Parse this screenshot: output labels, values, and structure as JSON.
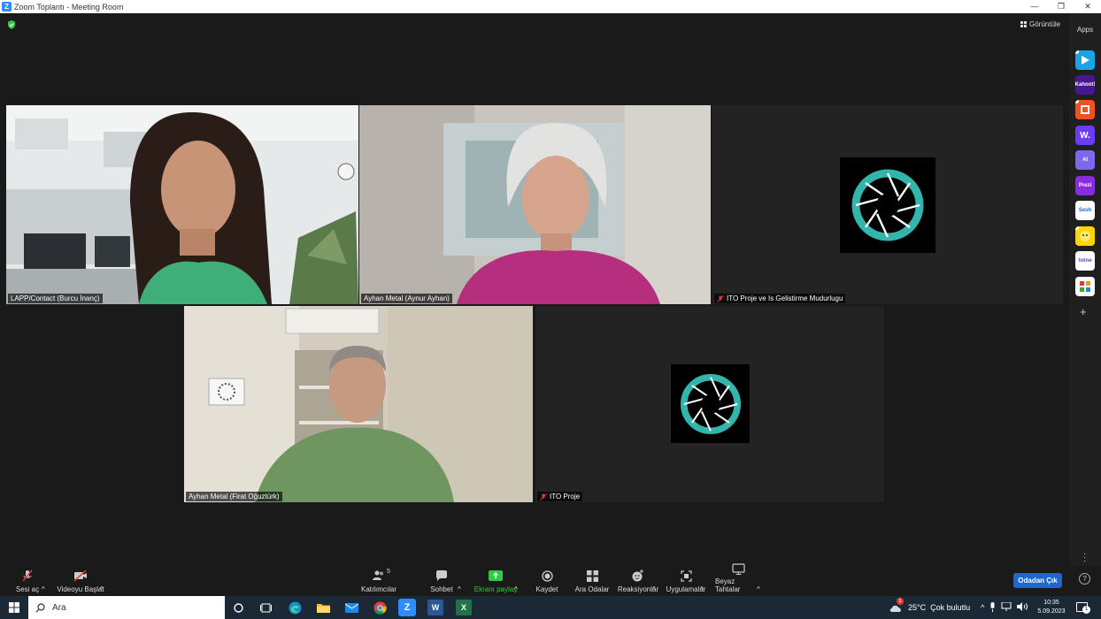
{
  "window": {
    "title": "Zoom Toplantı - Meeting Room",
    "controls": [
      "—",
      "❐",
      "✕"
    ]
  },
  "view_button": {
    "label": "Görüntüle"
  },
  "sidebar": {
    "title": "Apps",
    "apps": [
      {
        "name": "app-1",
        "label": "",
        "color": "#1aa3e8"
      },
      {
        "name": "kahoot",
        "label": "Kahoot!",
        "color": "#46178f"
      },
      {
        "name": "app-3",
        "label": "",
        "color": "#f25022"
      },
      {
        "name": "wooclap",
        "label": "W.",
        "color": "#6c3bf5"
      },
      {
        "name": "app-5",
        "label": "AI",
        "color": "#7b68ee"
      },
      {
        "name": "prezi",
        "label": "Prezi",
        "color": "#8a2be2"
      },
      {
        "name": "sesh",
        "label": "Sesh",
        "color": "#ffffff"
      },
      {
        "name": "app-8",
        "label": "",
        "color": "#ffd400"
      },
      {
        "name": "twine",
        "label": "twine",
        "color": "#ffffff"
      },
      {
        "name": "app-10",
        "label": "",
        "color": "#ffffff"
      }
    ]
  },
  "participants": [
    {
      "name": "LAPP/Contact (Burcu İnanç)",
      "muted": false,
      "active": true
    },
    {
      "name": "Ayhan Metal (Aynur Ayhan)",
      "muted": false,
      "active": false
    },
    {
      "name": "ITO Proje ve Is Gelistirme Mudurlugu",
      "muted": true,
      "active": false
    },
    {
      "name": "Ayhan Metal (Firat Oğuztürk)",
      "muted": false,
      "active": false
    },
    {
      "name": "ITO Proje",
      "muted": true,
      "active": false
    }
  ],
  "toolbar": {
    "audio": "Sesi aç",
    "video": "Videoyu Başlat",
    "participants": "Katılımcılar",
    "participants_count": "5",
    "chat": "Sohbet",
    "share": "Ekranı paylaş",
    "record": "Kaydet",
    "breakout": "Ara Odalar",
    "reactions": "Reaksiyonlar",
    "apps": "Uygulamalar",
    "whiteboards": "Beyaz Tahtalar",
    "leave": "Odadan Çık"
  },
  "taskbar": {
    "search_placeholder": "Ara",
    "weather": "25°C  Çok bulutlu",
    "weather_badge": "1",
    "time": "10:35",
    "date": "5.09.2023",
    "notification_count": "1"
  },
  "colors": {
    "accent_blue": "#1e66d0",
    "active_speaker": "#b8e51c",
    "share_green": "#2ecc40",
    "muted_red": "#e53935",
    "logo_teal": "#33b5ae"
  }
}
